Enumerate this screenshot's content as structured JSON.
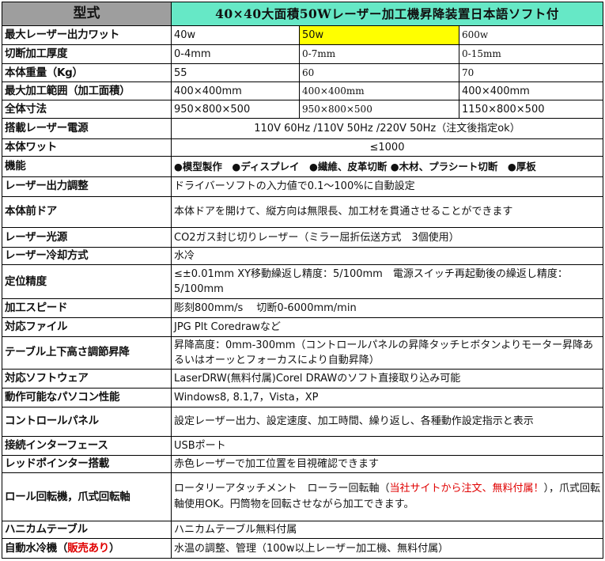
{
  "header": {
    "label": "型式",
    "title": "40×40大面積50Wレーザー加工機昇降装置日本語ソフト付"
  },
  "rows": {
    "power": {
      "label": "最大レーザー出力ワット",
      "v1": "40w",
      "v2": "50w",
      "v3": "600w"
    },
    "cut_thickness": {
      "label": "切断加工厚度",
      "v1": "0-4mm",
      "v2": "0-7mm",
      "v3": "0-15mm"
    },
    "weight": {
      "label": "本体重量（Kg）",
      "v1": "55",
      "v2": "60",
      "v3": "70"
    },
    "work_area": {
      "label": "最大加工範囲（加工面積）",
      "v1": "400×400mm",
      "v2": "400×400mm",
      "v3": "400×400mm"
    },
    "dimensions": {
      "label": "全体寸法",
      "v1": "950×800×500",
      "v2": "950×800×500",
      "v3": "1150×800×500"
    },
    "power_supply": {
      "label": "搭載レーザー電源",
      "value": "110V 60Hz  /110V 50Hz  /220V 50Hz（注文後指定ok）"
    },
    "body_watt": {
      "label": "本体ワット",
      "value": "≤1000"
    },
    "functions": {
      "label": "機能",
      "value": "●模型製作　●ディスプレイ　●繊維、皮革切断 ●木材、プラシート切断　●厚板"
    },
    "output_adjust": {
      "label": "レーザー出力調整",
      "value": "ドライバーソフトの入力値で0.1～100%に自動設定"
    },
    "front_door": {
      "label": "本体前ドア",
      "value": "本体ドアを開けて、縦方向は無限長、加工材を貫通させることができます"
    },
    "source": {
      "label": "レーザー光源",
      "value": "CO2ガス封じ切りレーザー（ミラー屈折伝送方式　3個使用）"
    },
    "cooling": {
      "label": "レーザー冷却方式",
      "value": "水冷"
    },
    "accuracy": {
      "label": "定位精度",
      "value": "≤±0.01mm XY移動繰返し精度：5/100mm　電源スイッチ再起動後の繰返し精度：5/100mm"
    },
    "speed": {
      "label": "加工スピード",
      "value": "彫刻800mm/s　 切断0-6000mm/min"
    },
    "files": {
      "label": "対応ファイル",
      "value": "JPG  Plt  Coredrawなど"
    },
    "table_lift": {
      "label": "テーブル上下高さ調節昇降",
      "value": "昇降高度：0mm-300mm（コントロールパネルの昇降タッチヒボタンよりモーター昇降あるいはオーッとフォーカスにより自動昇降）"
    },
    "software": {
      "label": "対応ソフトウェア",
      "value": "LaserDRW(無料付属)Corel DRAWのソフト直接取り込み可能"
    },
    "pc": {
      "label": "動作可能なパソコン性能",
      "value": "Windows8, 8.1,7，Vista，XP"
    },
    "panel": {
      "label": "コントロールパネル",
      "value": "設定レーザー出力、設定速度、加工時間、繰り返し、各種動作設定指示と表示"
    },
    "interface": {
      "label": "接続インターフェース",
      "value": "USBポート"
    },
    "red_pointer": {
      "label": "レッドポインター搭載",
      "value": "赤色レーザーで加工位置を目視確認できます"
    },
    "rotary": {
      "label": "ロール回転機，爪式回転軸",
      "value_a": "ロータリーアタッチメント　ローラー回転軸（",
      "value_red": "当社サイトから注文、無料付属！",
      "value_b": "），爪式回転軸使用OK。円筒物を回転させながら加工できます。"
    },
    "honeycomb": {
      "label": "ハニカムテーブル",
      "value": "ハニカムテーブル無料付属"
    },
    "chiller": {
      "label_a": "自動水冷機（",
      "label_red": "販売あり",
      "label_b": "）",
      "value": "水温の調整、管理（100w以上レーザー加工機、無料付属）"
    }
  },
  "colors": {
    "header_label_bg": "#9e9e9e",
    "header_title_bg": "#66e8c6",
    "highlight": "#ffff00",
    "accent_red": "#e00000"
  }
}
